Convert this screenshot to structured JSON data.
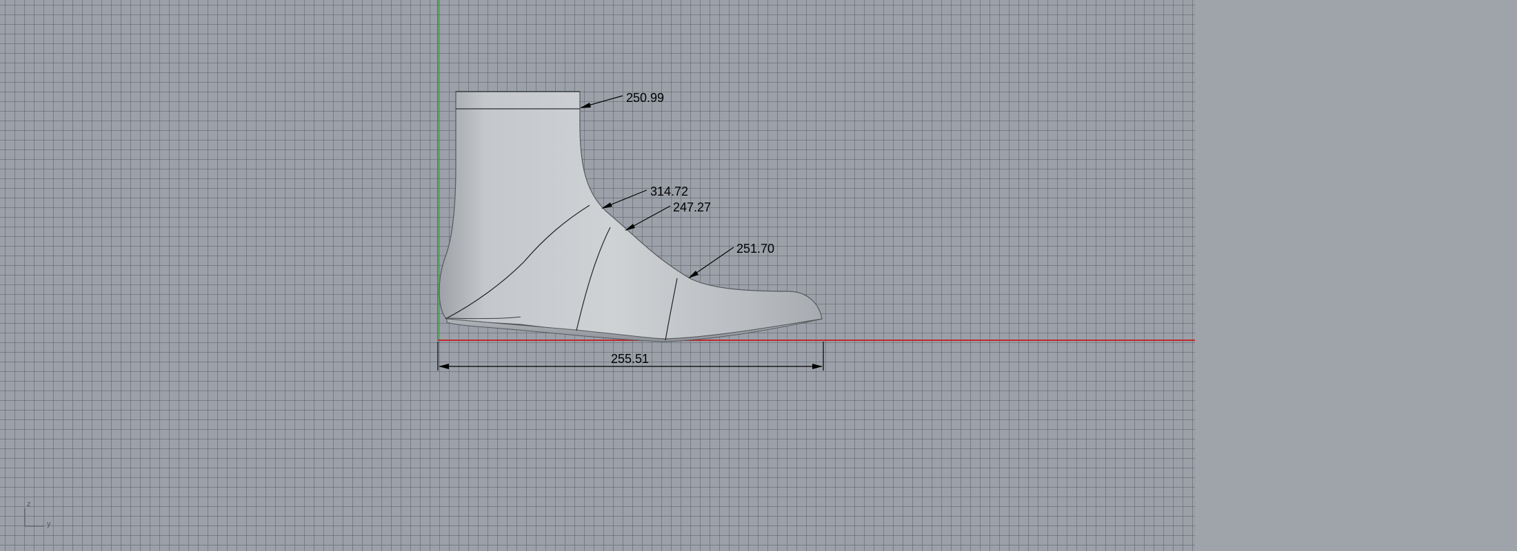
{
  "viewport": {
    "background": "#9ba0a9",
    "grid_color": "#5a6068",
    "x_axis_color": "#c0282c",
    "y_axis_color": "#2e9e3a"
  },
  "model": {
    "name": "boot-last",
    "fill": "#c8cbcf"
  },
  "dimensions": {
    "top_girth": "250.99",
    "instep_girth_1": "314.72",
    "instep_girth_2": "247.27",
    "ball_girth": "251.70",
    "length": "255.51"
  },
  "axis_widget": {
    "z_label": "z",
    "y_label": "y"
  }
}
